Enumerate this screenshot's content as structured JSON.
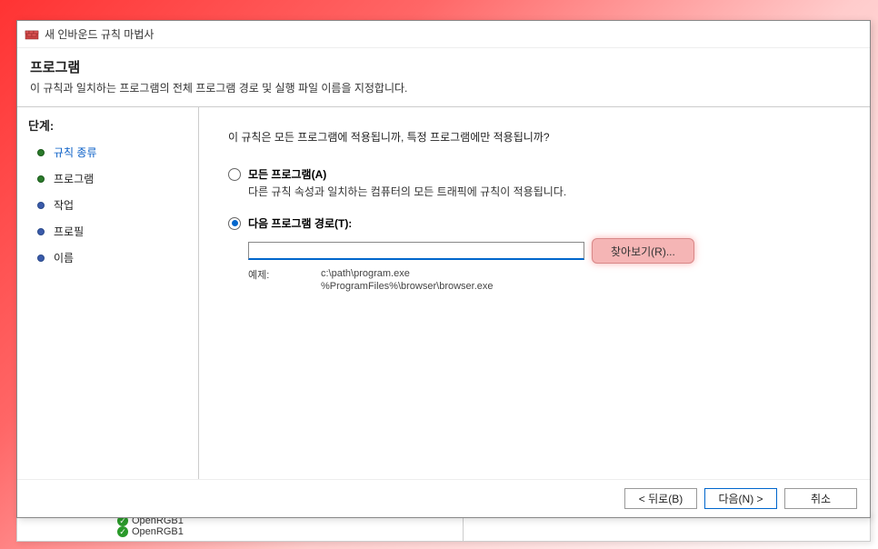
{
  "window": {
    "title": "새 인바운드 규칙 마법사"
  },
  "header": {
    "title": "프로그램",
    "description": "이 규칙과 일치하는 프로그램의 전체 프로그램 경로 및 실행 파일 이름을 지정합니다."
  },
  "sidebar": {
    "header": "단계:",
    "steps": [
      {
        "label": "규칙 종류",
        "active": true
      },
      {
        "label": "프로그램",
        "active": false
      },
      {
        "label": "작업",
        "active": false
      },
      {
        "label": "프로필",
        "active": false
      },
      {
        "label": "이름",
        "active": false
      }
    ]
  },
  "content": {
    "question": "이 규칙은 모든 프로그램에 적용됩니까, 특정 프로그램에만 적용됩니까?",
    "option_all": {
      "label": "모든 프로그램(A)",
      "description": "다른 규칙 속성과 일치하는 컴퓨터의 모든 트래픽에 규칙이 적용됩니다."
    },
    "option_path": {
      "label": "다음 프로그램 경로(T):",
      "value": "",
      "browse_label": "찾아보기(R)..."
    },
    "example": {
      "label": "예제:",
      "line1": "c:\\path\\program.exe",
      "line2": "%ProgramFiles%\\browser\\browser.exe"
    }
  },
  "footer": {
    "back": "< 뒤로(B)",
    "next": "다음(N) >",
    "cancel": "취소"
  },
  "background": {
    "item1": "OpenRGB1",
    "item2": "OpenRGB1"
  }
}
